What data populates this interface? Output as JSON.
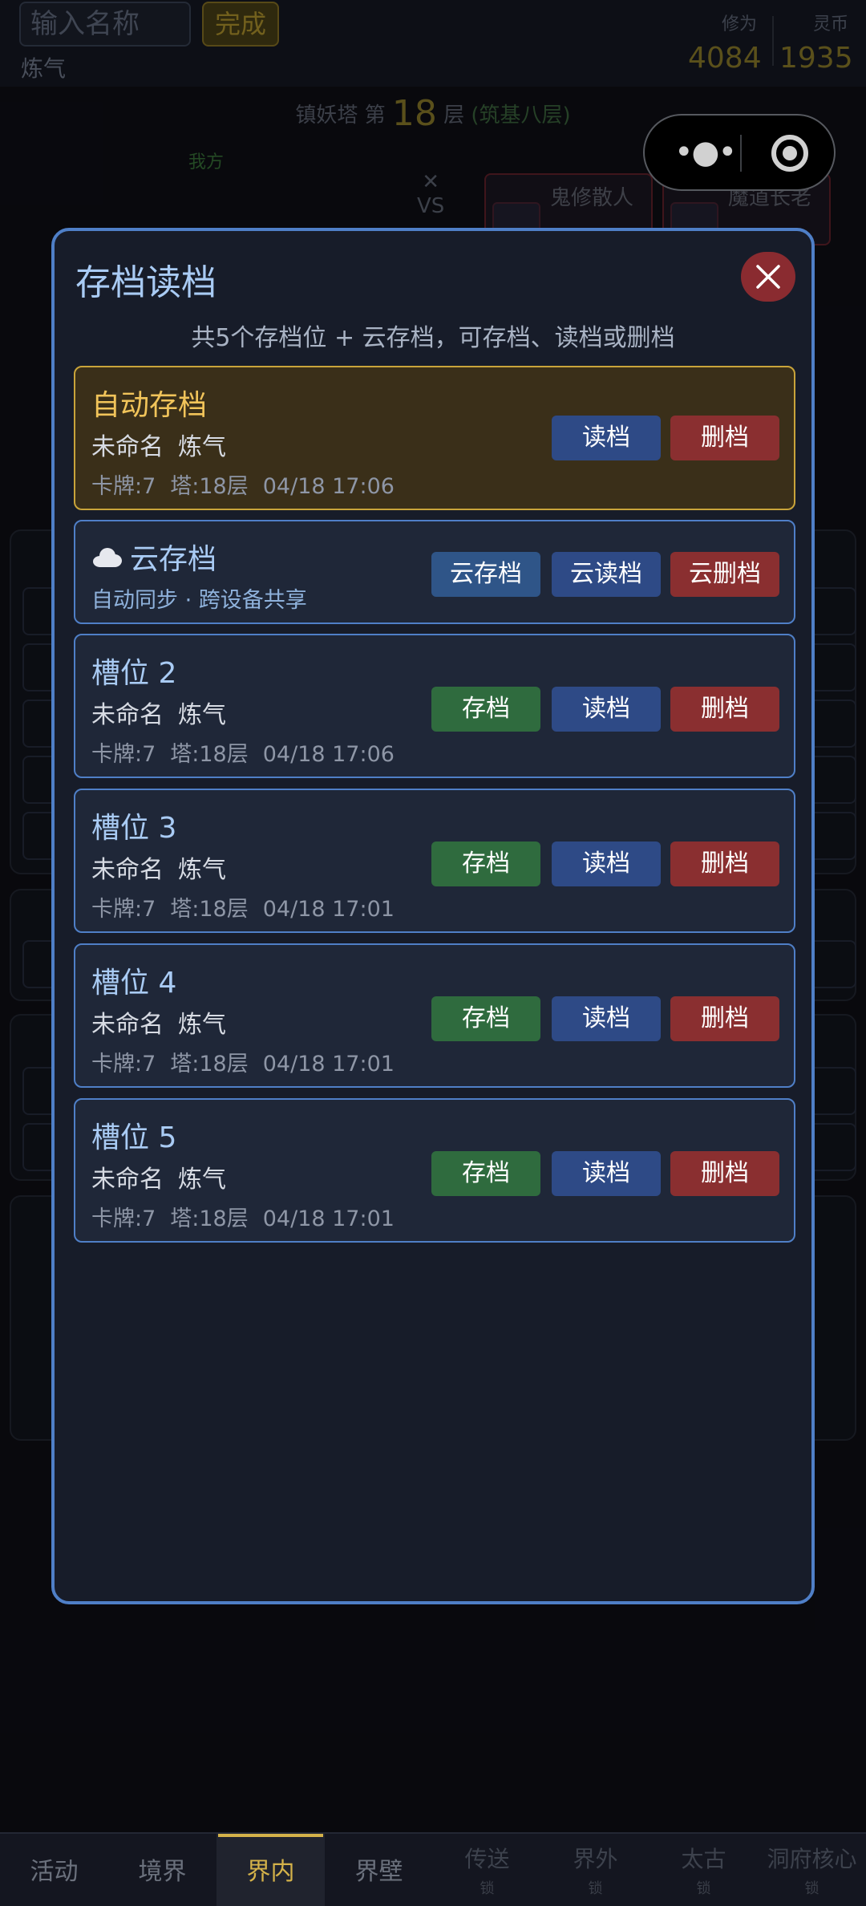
{
  "background": {
    "name_input_placeholder": "输入名称",
    "done_label": "完成",
    "realm": "炼气",
    "cultivation_label": "修为",
    "cultivation_value": "4084",
    "currency_label": "灵币",
    "currency_value": "1935",
    "tower_prefix": "镇妖塔 第",
    "tower_floor": "18",
    "tower_suffix": "层",
    "tower_stage": "(筑基八层)",
    "my_side": "我方",
    "vs": "VS",
    "enemies": [
      "鬼修散人",
      "魔道长老"
    ]
  },
  "modal": {
    "title": "存档读档",
    "subtitle": "共5个存档位 + 云存档，可存档、读档或删档",
    "slots": [
      {
        "title": "自动存档",
        "name": "未命名",
        "realm": "炼气",
        "cards": "卡牌:7",
        "tower": "塔:18层",
        "time": "04/18 17:06",
        "load": "读档",
        "delete": "删档"
      },
      {
        "title": "云存档",
        "sub": "自动同步 · 跨设备共享",
        "cloud_save": "云存档",
        "cloud_load": "云读档",
        "cloud_delete": "云删档"
      },
      {
        "title": "槽位 2",
        "name": "未命名",
        "realm": "炼气",
        "cards": "卡牌:7",
        "tower": "塔:18层",
        "time": "04/18 17:06",
        "save": "存档",
        "load": "读档",
        "delete": "删档"
      },
      {
        "title": "槽位 3",
        "name": "未命名",
        "realm": "炼气",
        "cards": "卡牌:7",
        "tower": "塔:18层",
        "time": "04/18 17:01",
        "save": "存档",
        "load": "读档",
        "delete": "删档"
      },
      {
        "title": "槽位 4",
        "name": "未命名",
        "realm": "炼气",
        "cards": "卡牌:7",
        "tower": "塔:18层",
        "time": "04/18 17:01",
        "save": "存档",
        "load": "读档",
        "delete": "删档"
      },
      {
        "title": "槽位 5",
        "name": "未命名",
        "realm": "炼气",
        "cards": "卡牌:7",
        "tower": "塔:18层",
        "time": "04/18 17:01",
        "save": "存档",
        "load": "读档",
        "delete": "删档"
      }
    ]
  },
  "nav": {
    "items": [
      {
        "label": "活动"
      },
      {
        "label": "境界"
      },
      {
        "label": "界内",
        "active": true
      },
      {
        "label": "界壁"
      },
      {
        "label": "传送",
        "lock": "锁"
      },
      {
        "label": "界外",
        "lock": "锁"
      },
      {
        "label": "太古",
        "lock": "锁"
      },
      {
        "label": "洞府核心",
        "lock": "锁"
      }
    ]
  },
  "colors": {
    "accent": "#4f7fc7",
    "gold": "#f1c45a",
    "save": "#2f6b3e",
    "load": "#2e4a86",
    "delete": "#8a2f30"
  }
}
